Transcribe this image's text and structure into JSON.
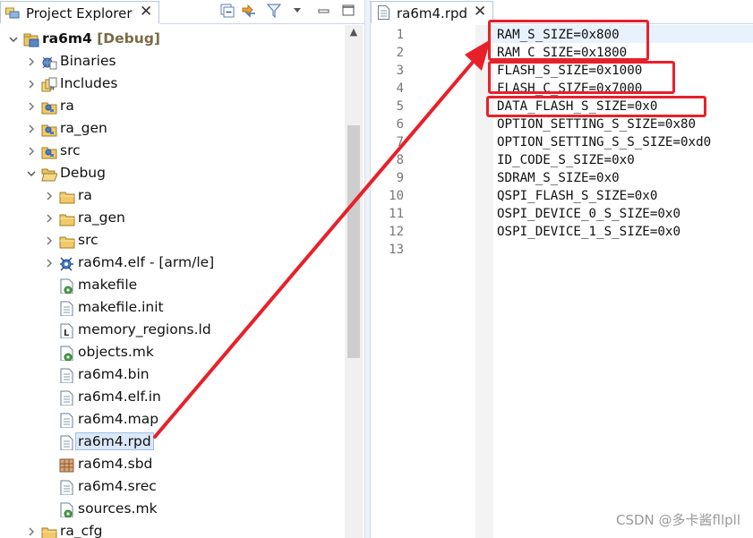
{
  "explorer": {
    "tab_label": "Project Explorer",
    "close_glyph": "✕",
    "toolbar": [
      "collapse-all-icon",
      "link-with-editor-icon",
      "filter-icon",
      "view-menu-icon",
      "minimize-icon",
      "maximize-icon"
    ],
    "items": [
      {
        "name": "ra6m4",
        "suffix": " [Debug]",
        "icon": "project-icon",
        "twisty": "expanded",
        "level": 0
      },
      {
        "name": "Binaries",
        "icon": "binaries-icon",
        "twisty": "collapsed",
        "level": 1
      },
      {
        "name": "Includes",
        "icon": "includes-icon",
        "twisty": "collapsed",
        "level": 1
      },
      {
        "name": "ra",
        "icon": "source-folder-icon",
        "twisty": "collapsed",
        "level": 1
      },
      {
        "name": "ra_gen",
        "icon": "source-folder-icon",
        "twisty": "collapsed",
        "level": 1
      },
      {
        "name": "src",
        "icon": "source-folder-icon",
        "twisty": "collapsed",
        "level": 1
      },
      {
        "name": "Debug",
        "icon": "folder-open-icon",
        "twisty": "expanded",
        "level": 1
      },
      {
        "name": "ra",
        "icon": "folder-icon",
        "twisty": "collapsed",
        "level": 2
      },
      {
        "name": "ra_gen",
        "icon": "folder-icon",
        "twisty": "collapsed",
        "level": 2
      },
      {
        "name": "src",
        "icon": "folder-icon",
        "twisty": "collapsed",
        "level": 2
      },
      {
        "name": "ra6m4.elf - [arm/le]",
        "icon": "elf-binary-icon",
        "twisty": "collapsed",
        "level": 2
      },
      {
        "name": "makefile",
        "icon": "makefile-icon",
        "twisty": "none",
        "level": 2
      },
      {
        "name": "makefile.init",
        "icon": "file-icon",
        "twisty": "none",
        "level": 2
      },
      {
        "name": "memory_regions.ld",
        "icon": "linker-script-icon",
        "twisty": "none",
        "level": 2
      },
      {
        "name": "objects.mk",
        "icon": "makefile-icon",
        "twisty": "none",
        "level": 2
      },
      {
        "name": "ra6m4.bin",
        "icon": "file-icon",
        "twisty": "none",
        "level": 2
      },
      {
        "name": "ra6m4.elf.in",
        "icon": "file-icon",
        "twisty": "none",
        "level": 2
      },
      {
        "name": "ra6m4.map",
        "icon": "file-icon",
        "twisty": "none",
        "level": 2
      },
      {
        "name": "ra6m4.rpd",
        "icon": "file-icon",
        "twisty": "none",
        "level": 2,
        "selected": true
      },
      {
        "name": "ra6m4.sbd",
        "icon": "sbd-file-icon",
        "twisty": "none",
        "level": 2
      },
      {
        "name": "ra6m4.srec",
        "icon": "file-icon",
        "twisty": "none",
        "level": 2
      },
      {
        "name": "sources.mk",
        "icon": "makefile-icon",
        "twisty": "none",
        "level": 2
      },
      {
        "name": "ra_cfg",
        "icon": "folder-icon",
        "twisty": "collapsed",
        "level": 1
      }
    ]
  },
  "editor": {
    "tab_label": "ra6m4.rpd",
    "close_glyph": "✕",
    "lines": [
      {
        "n": "1",
        "text": "RAM_S_SIZE=0x800"
      },
      {
        "n": "2",
        "text": "RAM_C_SIZE=0x1800"
      },
      {
        "n": "3",
        "text": "FLASH_S_SIZE=0x1000"
      },
      {
        "n": "4",
        "text": "FLASH_C_SIZE=0x7000"
      },
      {
        "n": "5",
        "text": "DATA_FLASH_S_SIZE=0x0"
      },
      {
        "n": "6",
        "text": "OPTION_SETTING_S_SIZE=0x80"
      },
      {
        "n": "7",
        "text": "OPTION_SETTING_S_S_SIZE=0xd0"
      },
      {
        "n": "8",
        "text": "ID_CODE_S_SIZE=0x0"
      },
      {
        "n": "9",
        "text": "SDRAM_S_SIZE=0x0"
      },
      {
        "n": "10",
        "text": "QSPI_FLASH_S_SIZE=0x0"
      },
      {
        "n": "11",
        "text": "OSPI_DEVICE_0_S_SIZE=0x0"
      },
      {
        "n": "12",
        "text": "OSPI_DEVICE_1_S_SIZE=0x0"
      },
      {
        "n": "13",
        "text": ""
      }
    ]
  },
  "annotations": {
    "highlight_color": "#e8202a",
    "highlighted_groups": [
      [
        1,
        2
      ],
      [
        3,
        4
      ],
      [
        5
      ]
    ],
    "arrow": {
      "from": "ra6m4.rpd",
      "to": "editor line 1"
    }
  },
  "watermark": "CSDN @多卡酱fllpll"
}
